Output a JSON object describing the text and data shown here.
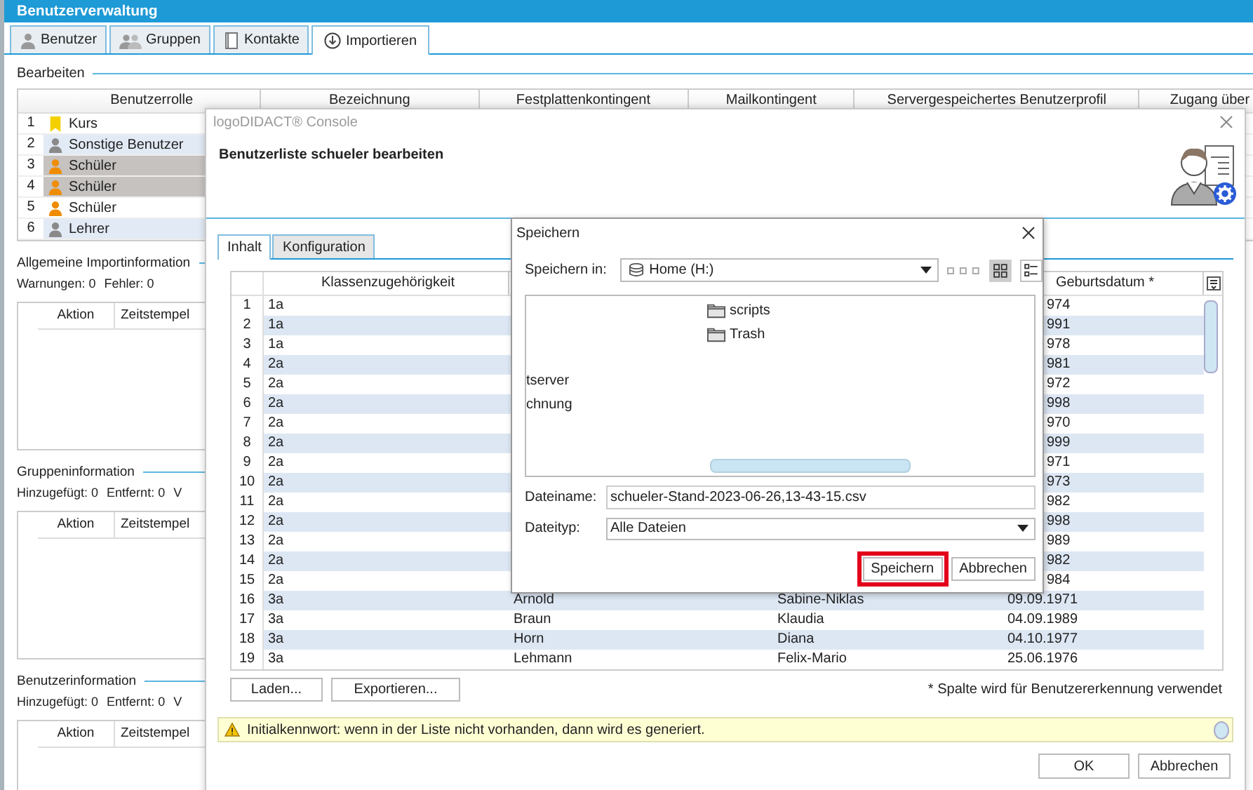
{
  "window": {
    "title": "Benutzerverwaltung"
  },
  "tabs": [
    {
      "label": "Benutzer",
      "kind": "person",
      "selected": false
    },
    {
      "label": "Gruppen",
      "kind": "group",
      "selected": false
    },
    {
      "label": "Kontakte",
      "kind": "book",
      "selected": false
    },
    {
      "label": "Importieren",
      "kind": "import",
      "selected": true
    }
  ],
  "edit_section": {
    "title": "Bearbeiten",
    "columns": [
      "Benutzerrolle",
      "Bezeichnung",
      "Festplattenkontingent",
      "Mailkontingent",
      "Servergespeichertes Benutzerprofil",
      "Zugang über"
    ],
    "rows": [
      {
        "number": "1",
        "role": "Kurs",
        "kind": "course",
        "color": "#f5d000",
        "selected": false
      },
      {
        "number": "2",
        "role": "Sonstige Benutzer",
        "kind": "person",
        "color": "#8a8a8a",
        "selected": false
      },
      {
        "number": "3",
        "role": "Schüler",
        "kind": "person",
        "color": "#f08c00",
        "selected": true
      },
      {
        "number": "4",
        "role": "Schüler",
        "kind": "person",
        "color": "#f08c00",
        "selected": true
      },
      {
        "number": "5",
        "role": "Schüler",
        "kind": "person",
        "color": "#f08c00",
        "selected": false
      },
      {
        "number": "6",
        "role": "Lehrer",
        "kind": "person",
        "color": "#8a8a8a",
        "selected": false
      }
    ]
  },
  "info_sections": [
    {
      "title": "Allgemeine Importinformation",
      "counts": [
        "Warnungen: 0",
        "Fehler: 0"
      ],
      "columns": [
        "Aktion",
        "Zeitstempel"
      ]
    },
    {
      "title": "Gruppeninformation",
      "counts": [
        "Hinzugefügt: 0",
        "Entfernt: 0",
        "V"
      ],
      "columns": [
        "Aktion",
        "Zeitstempel"
      ]
    },
    {
      "title": "Benutzerinformation",
      "counts": [
        "Hinzugefügt: 0",
        "Entfernt: 0",
        "V"
      ],
      "columns": [
        "Aktion",
        "Zeitstempel"
      ]
    }
  ],
  "console_dialog": {
    "title": "logoDIDACT® Console",
    "heading": "Benutzerliste schueler bearbeiten",
    "tabs": [
      {
        "label": "Inhalt",
        "selected": true
      },
      {
        "label": "Konfiguration",
        "selected": false
      }
    ],
    "columns": [
      "Klassenzugehörigkeit",
      "",
      "",
      "Geburtsdatum *"
    ],
    "rows": [
      {
        "number": "1",
        "class": "1a",
        "last_name": "",
        "first_name": "",
        "birth_date": "974",
        "cut": true
      },
      {
        "number": "2",
        "class": "1a",
        "last_name": "",
        "first_name": "",
        "birth_date": "991",
        "cut": true
      },
      {
        "number": "3",
        "class": "1a",
        "last_name": "",
        "first_name": "",
        "birth_date": "978",
        "cut": true
      },
      {
        "number": "4",
        "class": "2a",
        "last_name": "",
        "first_name": "",
        "birth_date": "981",
        "cut": true
      },
      {
        "number": "5",
        "class": "2a",
        "last_name": "",
        "first_name": "",
        "birth_date": "972",
        "cut": true
      },
      {
        "number": "6",
        "class": "2a",
        "last_name": "",
        "first_name": "",
        "birth_date": "998",
        "cut": true
      },
      {
        "number": "7",
        "class": "2a",
        "last_name": "",
        "first_name": "",
        "birth_date": "970",
        "cut": true
      },
      {
        "number": "8",
        "class": "2a",
        "last_name": "",
        "first_name": "",
        "birth_date": "999",
        "cut": true
      },
      {
        "number": "9",
        "class": "2a",
        "last_name": "",
        "first_name": "",
        "birth_date": "971",
        "cut": true
      },
      {
        "number": "10",
        "class": "2a",
        "last_name": "",
        "first_name": "",
        "birth_date": "973",
        "cut": true
      },
      {
        "number": "11",
        "class": "2a",
        "last_name": "",
        "first_name": "",
        "birth_date": "982",
        "cut": true
      },
      {
        "number": "12",
        "class": "2a",
        "last_name": "",
        "first_name": "",
        "birth_date": "998",
        "cut": true
      },
      {
        "number": "13",
        "class": "2a",
        "last_name": "",
        "first_name": "",
        "birth_date": "989",
        "cut": true
      },
      {
        "number": "14",
        "class": "2a",
        "last_name": "",
        "first_name": "",
        "birth_date": "982",
        "cut": true
      },
      {
        "number": "15",
        "class": "2a",
        "last_name": "",
        "first_name": "",
        "birth_date": "984",
        "cut": true
      },
      {
        "number": "16",
        "class": "3a",
        "last_name": "Arnold",
        "first_name": "Sabine-Niklas",
        "birth_date": "09.09.1971",
        "cut": false
      },
      {
        "number": "17",
        "class": "3a",
        "last_name": "Braun",
        "first_name": "Klaudia",
        "birth_date": "04.09.1989",
        "cut": false
      },
      {
        "number": "18",
        "class": "3a",
        "last_name": "Horn",
        "first_name": "Diana",
        "birth_date": "04.10.1977",
        "cut": false
      },
      {
        "number": "19",
        "class": "3a",
        "last_name": "Lehmann",
        "first_name": "Felix-Mario",
        "birth_date": "25.06.1976",
        "cut": false
      }
    ],
    "load_button": "Laden...",
    "export_button": "Exportieren...",
    "note": "* Spalte wird für Benutzererkennung verwendet",
    "warning": "Initialkennwort: wenn in der Liste nicht vorhanden, dann wird es generiert.",
    "buttons": [
      "OK",
      "Abbrechen"
    ]
  },
  "save_dialog": {
    "title": "Speichern",
    "location_label": "Speichern in:",
    "location": "Home (H:)",
    "files": [
      {
        "name": "scripts",
        "kind": "folder"
      },
      {
        "name": "Trash",
        "kind": "folder"
      },
      {
        "name": "tserver",
        "kind": "cut"
      },
      {
        "name": "chnung",
        "kind": "cut"
      }
    ],
    "filename_label": "Dateiname:",
    "filename": "schueler-Stand-2023-06-26,13-43-15.csv",
    "filetype_label": "Dateityp:",
    "filetype": "Alle Dateien",
    "buttons": [
      {
        "label": "Speichern",
        "highlighted": true
      },
      {
        "label": "Abbrechen",
        "highlighted": false
      }
    ]
  }
}
